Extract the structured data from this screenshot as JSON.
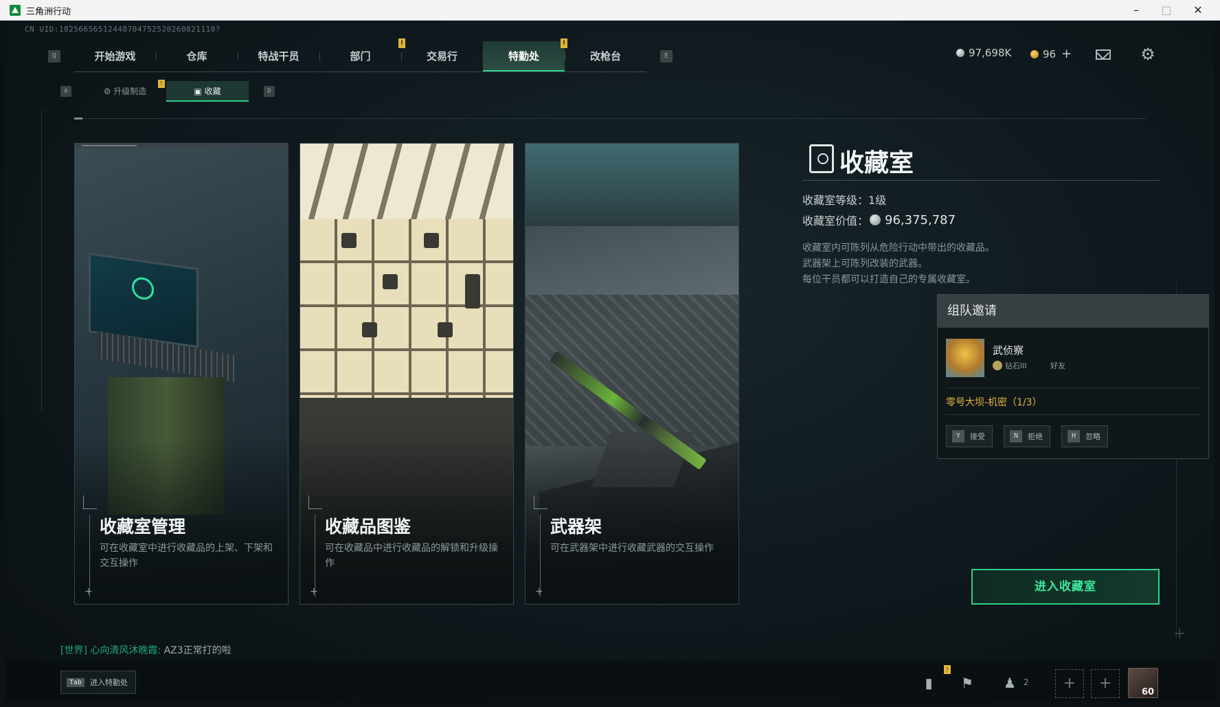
{
  "window": {
    "title": "三角洲行动"
  },
  "uid": "CN UID:18256656512448704752520260821110?",
  "nav": {
    "key_left": "Q",
    "key_right": "E",
    "tabs": [
      {
        "label": "开始游戏",
        "active": false,
        "alert": ""
      },
      {
        "label": "仓库",
        "active": false,
        "alert": ""
      },
      {
        "label": "特战干员",
        "active": false,
        "alert": ""
      },
      {
        "label": "部门",
        "active": false,
        "alert": "!"
      },
      {
        "label": "交易行",
        "active": false,
        "alert": ""
      },
      {
        "label": "特勤处",
        "active": true,
        "alert": "!"
      },
      {
        "label": "改枪台",
        "active": false,
        "alert": ""
      }
    ]
  },
  "currency": {
    "silver": "97,698K",
    "gold": "96",
    "add": "+"
  },
  "subnav": {
    "key_left": "A",
    "key_right": "D",
    "tabs": [
      {
        "label": "升级制造",
        "alert": "!"
      },
      {
        "label": "收藏",
        "alert": ""
      }
    ]
  },
  "cards": [
    {
      "title": "收藏室管理",
      "desc": "可在收藏室中进行收藏品的上架、下架和交互操作"
    },
    {
      "title": "收藏品图鉴",
      "desc": "可在收藏品中进行收藏品的解锁和升级操作"
    },
    {
      "title": "武器架",
      "desc": "可在武器架中进行收藏武器的交互操作"
    }
  ],
  "info": {
    "title": "收藏室",
    "level_label": "收藏室等级：",
    "level_value": "1级",
    "value_label": "收藏室价值：",
    "value_number": "96,375,787",
    "desc": [
      "收藏室内可陈列从危险行动中带出的收藏品。",
      "武器架上可陈列改装的武器。",
      "每位干员都可以打造自己的专属收藏室。"
    ]
  },
  "invite": {
    "header": "组队邀请",
    "name": "武侦察",
    "rank": "钻石III",
    "relation": "好友",
    "mode": "零号大坝-机密（1/3）",
    "accept": {
      "key": "Y",
      "label": "接受"
    },
    "reject": {
      "key": "N",
      "label": "拒绝"
    },
    "ignore": {
      "key": "H",
      "label": "忽略"
    }
  },
  "enter_button": "进入收藏室",
  "chat": {
    "channel": "[世界]",
    "sender": "心向清风沐晚霞:",
    "message": "AZ3正常打的啦"
  },
  "bottom": {
    "tab_key": "Tab",
    "tab_label": "进入特勤处",
    "stats_alert": "!",
    "friend_count": "2",
    "player_level": "60"
  },
  "icons": {
    "gear": "gear-icon",
    "mail": "mail-icon",
    "stats": "bar-chart-icon",
    "flag": "flag-icon",
    "friends": "friends-icon"
  },
  "colors": {
    "accent": "#2fd08a",
    "alert": "#e0b43a",
    "mode": "#e1b541"
  }
}
